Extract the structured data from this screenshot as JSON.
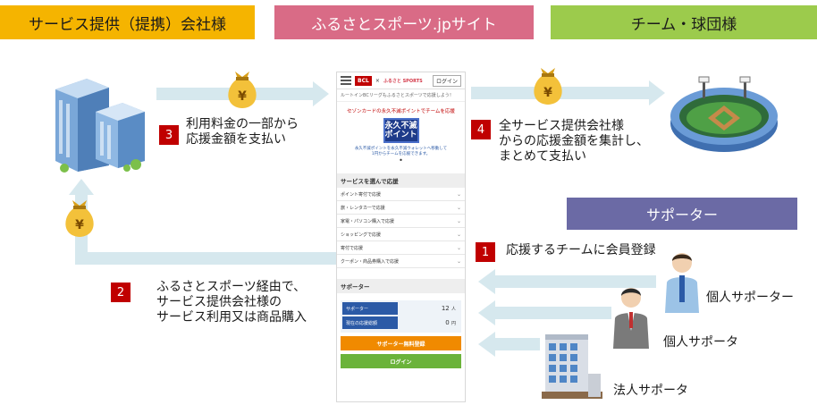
{
  "headers": {
    "left": "サービス提供（提携）会社様",
    "middle": "ふるさとスポーツ.jpサイト",
    "right": "チーム・球団様"
  },
  "steps": [
    {
      "number": "1",
      "text": "応援するチームに会員登録"
    },
    {
      "number": "2",
      "lines": [
        "ふるさとスポーツ経由で、",
        "サービス提供会社様の",
        "サービス利用又は商品購入"
      ]
    },
    {
      "number": "3",
      "lines": [
        "利用料金の一部から",
        "応援金額を支払い"
      ]
    },
    {
      "number": "4",
      "lines": [
        "全サービス提供会社様",
        "からの応援金額を集計し、",
        "まとめて支払い"
      ]
    }
  ],
  "supporter_header": "サポーター",
  "supporters": {
    "top": "個人サポーター",
    "middle": "個人サポータ",
    "bottom": "法人サポータ"
  },
  "money_symbol": "¥",
  "phone": {
    "bcl": "BCL",
    "x": "×",
    "sports": "ふるさと SPORTS",
    "login": "ログイン",
    "tagline": "ルートインBCリーグもふるさとスポーツで応援しよう！",
    "promo_title": "セゾンカードの永久不滅ポイントでチームを応援",
    "badge_top": "永久不滅",
    "badge_bottom": "ポイント",
    "promo_note_1": "永久不滅ポイントを永久不滅ウォレットへ移動して",
    "promo_note_2": "1円からチームを応援できます。",
    "dot": "•",
    "services_heading": "サービスを選んで応援",
    "services": [
      "ポイント寄付で応援",
      "旅・レンタカーで応援",
      "家電・パソコン購入で応援",
      "ショッピングで応援",
      "寄付で応援",
      "クーポン・商品券購入で応援"
    ],
    "chevron": "⌄",
    "supporter_heading": "サポーター",
    "supporter_count_label": "サポーター",
    "supporter_count_value": "12",
    "supporter_count_unit": "人",
    "support_total_label": "現在の応援総額",
    "support_total_value": "0",
    "support_total_unit": "円",
    "register_button": "サポーター無料登録",
    "login_button": "ログイン"
  },
  "colors": {
    "header_left": "#f5b400",
    "header_middle": "#d96b86",
    "header_right": "#9ccb4c",
    "step_badge": "#c00000",
    "supporter_header": "#6b6aa5",
    "arrow": "#d6e8ee"
  }
}
